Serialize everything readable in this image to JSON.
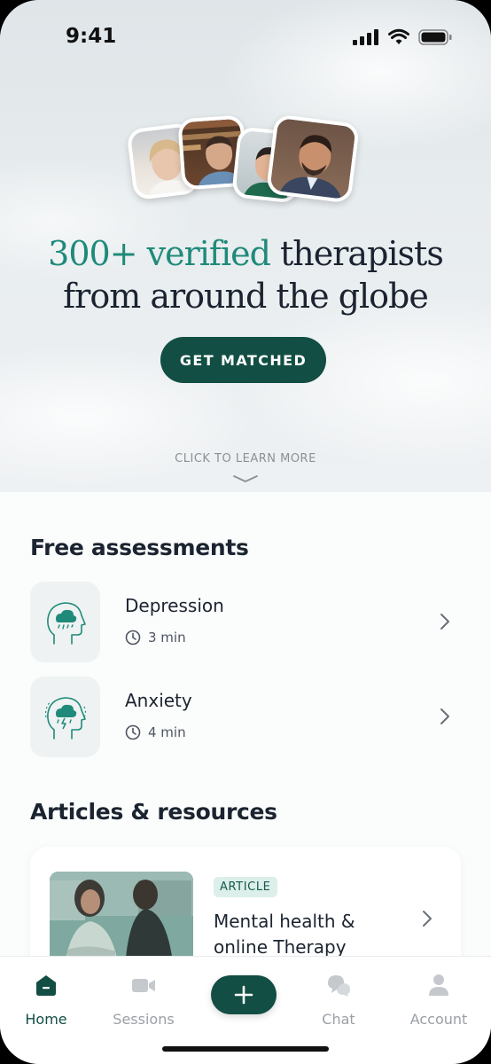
{
  "status_bar": {
    "time": "9:41"
  },
  "hero": {
    "headline_accent": "300+ verified",
    "headline_line1_rest": " therapists",
    "headline_line2": "from around the globe",
    "cta_label": "GET MATCHED",
    "learn_more": "CLICK TO LEARN MORE"
  },
  "assessments": {
    "title": "Free assessments",
    "items": [
      {
        "title": "Depression",
        "duration": "3 min"
      },
      {
        "title": "Anxiety",
        "duration": "4 min"
      }
    ]
  },
  "articles": {
    "title": "Articles & resources",
    "items": [
      {
        "badge": "ARTICLE",
        "title": "Mental health & online Therapy"
      }
    ]
  },
  "tabbar": {
    "items": [
      {
        "label": "Home",
        "icon": "home-icon",
        "active": true
      },
      {
        "label": "Sessions",
        "icon": "video-icon"
      },
      {
        "label": "",
        "icon": "plus-icon"
      },
      {
        "label": "Chat",
        "icon": "chat-icon"
      },
      {
        "label": "Account",
        "icon": "person-icon"
      }
    ]
  },
  "colors": {
    "brand": "#124e43",
    "accent": "#1f8a7a",
    "badge_bg": "#dcefea"
  }
}
